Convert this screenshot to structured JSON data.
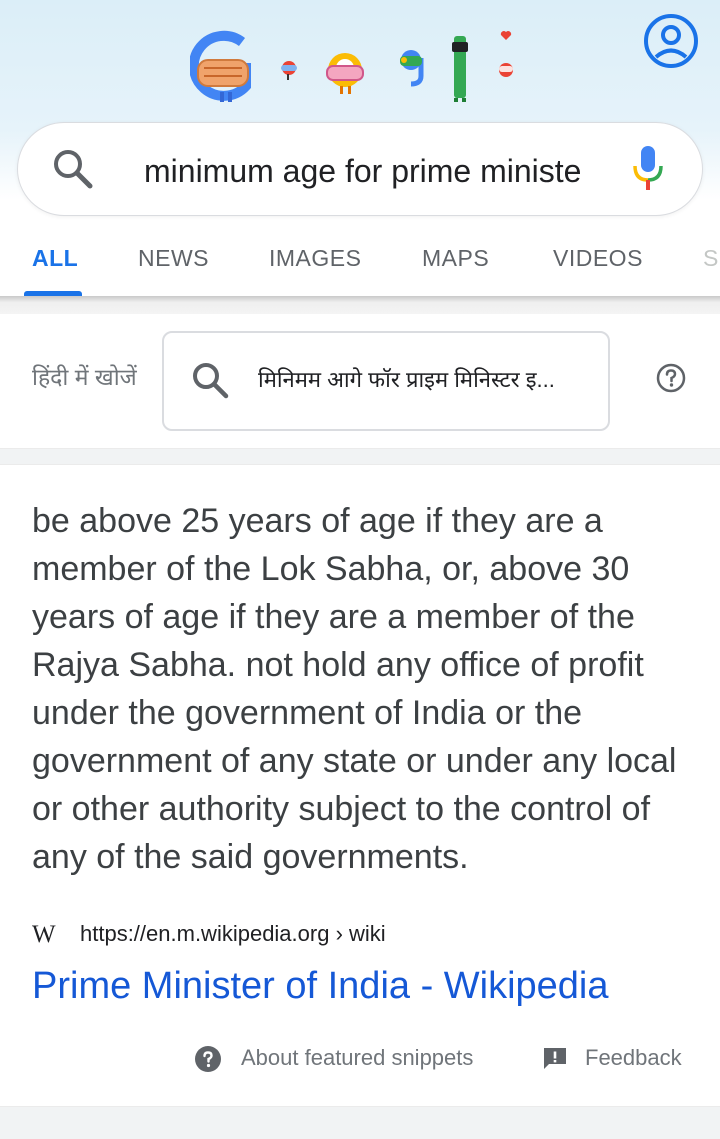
{
  "header": {
    "doodle_icon": "google-doodle-masked-letters",
    "account_icon": "account-circle-icon"
  },
  "search": {
    "query": "minimum age for prime ministe",
    "search_icon": "search-icon",
    "mic_icon": "microphone-icon"
  },
  "tabs": [
    {
      "label": "ALL",
      "active": true
    },
    {
      "label": "NEWS",
      "active": false
    },
    {
      "label": "IMAGES",
      "active": false
    },
    {
      "label": "MAPS",
      "active": false
    },
    {
      "label": "VIDEOS",
      "active": false
    },
    {
      "label": "S",
      "active": false
    }
  ],
  "hindi": {
    "label": "हिंदी में खोजें",
    "query": "मिनिमम आगे फॉर प्राइम मिनिस्टर इ...",
    "help_icon": "help-circle-icon"
  },
  "snippet": {
    "text": "be above 25 years of age if they are a member of the Lok Sabha, or, above 30 years of age if they are a member of the Rajya Sabha. not hold any office of profit under the government of India or the government of any state or under any local or other authority subject to the control of any of the said governments."
  },
  "source": {
    "logo": "W",
    "url": "https://en.m.wikipedia.org › wiki",
    "title": "Prime Minister of India - Wikipedia"
  },
  "footer": {
    "about": "About featured snippets",
    "feedback": "Feedback"
  },
  "colors": {
    "accent": "#1a73e8",
    "link": "#1558d6",
    "muted": "#70757a"
  }
}
